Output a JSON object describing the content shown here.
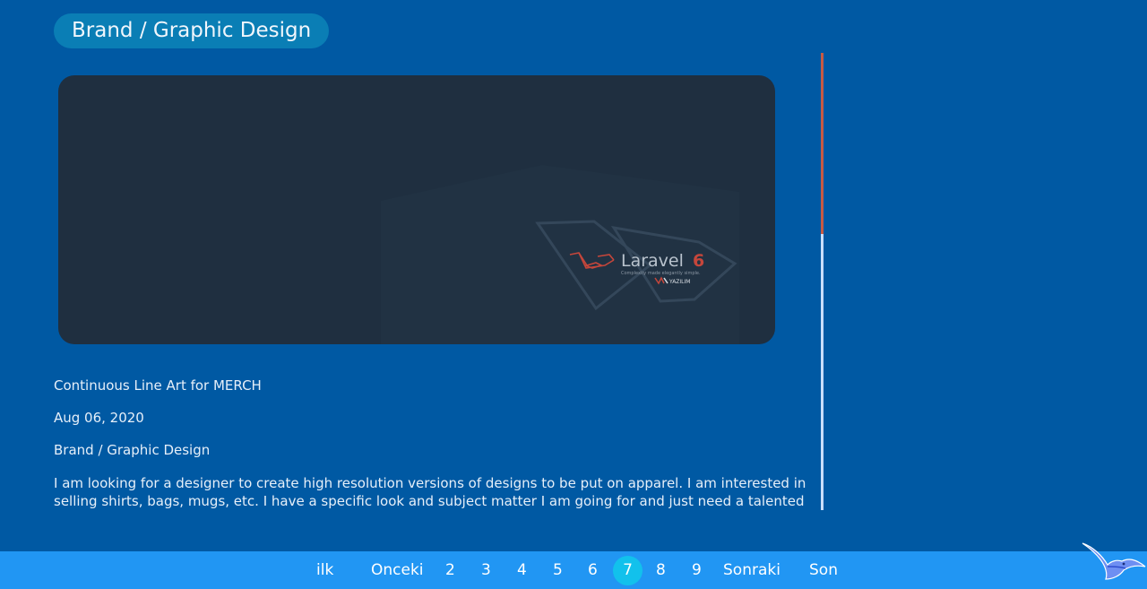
{
  "header": {
    "category_label": "Brand / Graphic Design"
  },
  "post": {
    "image": {
      "logo_text": "Laravel",
      "logo_number": "6",
      "logo_tagline": "Complexity made elegantly simple.",
      "brand_text": "YAZILIM",
      "accent_color": "#c5463b"
    },
    "title": "Continuous Line Art for MERCH",
    "date": "Aug 06, 2020",
    "category": "Brand / Graphic Design",
    "description": "I am looking for a designer to create high resolution versions of designs to be put on apparel. I am interested in selling shirts, bags, mugs, etc. I have a specific look and subject matter I am going for and just need a talented designer to"
  },
  "pagination": {
    "first": "ilk",
    "previous": "Onceki",
    "pages": [
      "2",
      "3",
      "4",
      "5",
      "6",
      "7",
      "8",
      "9"
    ],
    "current": "7",
    "next": "Sonraki",
    "last": "Son"
  },
  "colors": {
    "background": "#0059a3",
    "pill": "#0a7eb5",
    "pager_bar": "#2196f3",
    "pager_active": "#12c1ec",
    "scroll_thumb": "#c75a43",
    "scroll_track": "#c9defa"
  },
  "icons": {
    "corner_logo": "seagull-icon"
  }
}
